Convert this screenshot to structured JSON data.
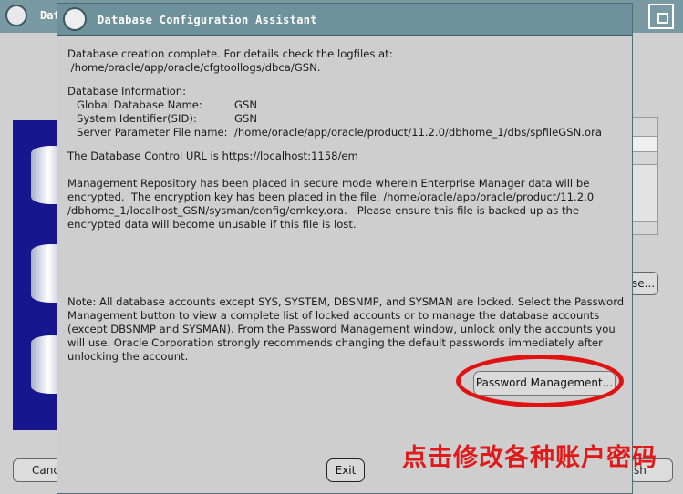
{
  "background_window": {
    "title_fragment": "Dat",
    "cancel_label_fragment": "Canc",
    "finish_label_fragment": "sh",
    "browse_label_fragment": "se..."
  },
  "dialog": {
    "title": "Database Configuration Assistant",
    "completion_line1": "Database creation complete. For details check the logfiles at:",
    "completion_line2": " /home/oracle/app/oracle/cfgtoollogs/dbca/GSN.",
    "info_heading": "Database Information:",
    "info": {
      "global_db_name_label": "Global Database Name:",
      "global_db_name_value": "GSN",
      "sid_label": "System Identifier(SID):",
      "sid_value": "GSN",
      "spfile_label": "Server Parameter File name:",
      "spfile_value": "/home/oracle/app/oracle/product/11.2.0/dbhome_1/dbs/spfileGSN.ora"
    },
    "control_url_line": "The Database Control URL is https://localhost:1158/em",
    "repository_lines": [
      "Management Repository has been placed in secure mode wherein Enterprise Manager data will be",
      "encrypted.  The encryption key has been placed in the file: /home/oracle/app/oracle/product/11.2.0",
      "/dbhome_1/localhost_GSN/sysman/config/emkey.ora.   Please ensure this file is backed up as the",
      "encrypted data will become unusable if this file is lost."
    ],
    "note_lines": [
      "Note: All database accounts except SYS, SYSTEM, DBSNMP, and SYSMAN are locked. Select the Password",
      "Management button to view a complete list of locked accounts or to manage the database accounts",
      "(except DBSNMP and SYSMAN). From the Password Management window, unlock only the accounts you",
      "will use. Oracle Corporation strongly recommends changing the default passwords immediately after",
      "unlocking the account."
    ],
    "password_management_label": "Password Management...",
    "exit_label": "Exit"
  },
  "annotation": {
    "text": "点击修改各种账户密码",
    "color": "#e01a1a"
  },
  "colors": {
    "titlebar": "#6e929b",
    "dialog_bg": "#cecece",
    "highlight_red": "#e01212"
  }
}
